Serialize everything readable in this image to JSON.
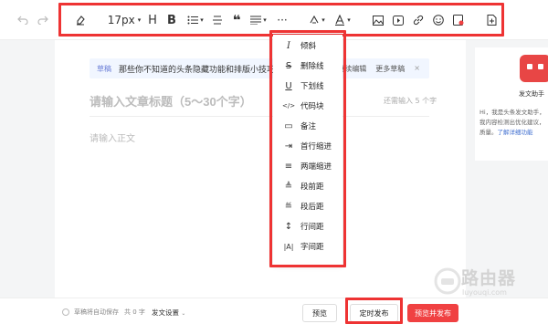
{
  "toolbar": {
    "font_size": "17px",
    "heading": "H",
    "bold": "B",
    "more": "···",
    "quote": "❝"
  },
  "dropdown": {
    "items": [
      {
        "icon": "italic-icon",
        "glyph": "I",
        "label": "倾斜"
      },
      {
        "icon": "strikethrough-icon",
        "glyph": "S",
        "label": "删除线"
      },
      {
        "icon": "underline-icon",
        "glyph": "U",
        "label": "下划线"
      },
      {
        "icon": "code-icon",
        "glyph": "</>",
        "label": "代码块"
      },
      {
        "icon": "note-icon",
        "glyph": "▭",
        "label": "备注"
      },
      {
        "icon": "first-line-indent-icon",
        "glyph": "⇥",
        "label": "首行缩进"
      },
      {
        "icon": "justify-icon",
        "glyph": "≡",
        "label": "两端缩进"
      },
      {
        "icon": "space-before-icon",
        "glyph": "≜",
        "label": "段前距"
      },
      {
        "icon": "space-after-icon",
        "glyph": "≝",
        "label": "段后距"
      },
      {
        "icon": "line-height-icon",
        "glyph": "↕",
        "label": "行间距"
      },
      {
        "icon": "letter-spacing-icon",
        "glyph": "|A|",
        "label": "字间距"
      }
    ]
  },
  "tip": {
    "badge": "草稿",
    "text": "那些你不知道的头条隐藏功能和排版小技巧。",
    "edit": "继续编辑",
    "more": "更多草稿",
    "close": "×"
  },
  "editor": {
    "title_placeholder": "请输入文章标题（5～30个字）",
    "title_count": "还需输入 5 个字",
    "body_placeholder": "请输入正文"
  },
  "side": {
    "title": "发文助手",
    "text_a": "Hi，我是头条发文助手，",
    "text_b": "我内容检测出优化建议，",
    "text_c": "质量。",
    "link": "了解详细功能"
  },
  "bottom": {
    "autosave": "草稿将自动保存",
    "word_count": "共 0 字",
    "publish_settings": "发文设置",
    "preview": "预览",
    "timed_publish": "定时发布",
    "preview_publish": "预览并发布"
  },
  "watermark": {
    "name": "路由器",
    "url": "luyouqi.com"
  },
  "colors": {
    "accent": "#f04142",
    "highlight_box": "#e33333",
    "link": "#406fd0"
  }
}
